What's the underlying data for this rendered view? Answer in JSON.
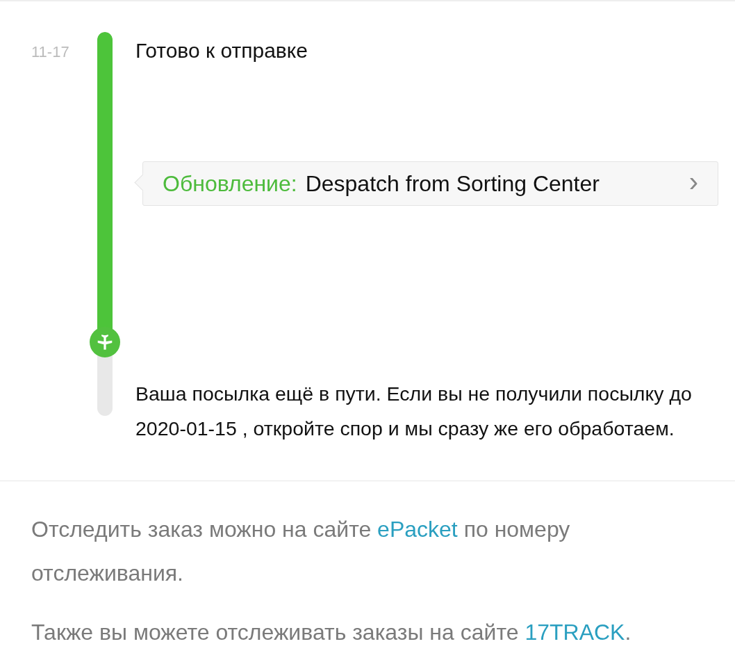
{
  "event": {
    "date": "11-17",
    "title": "Готово к отправке",
    "update": {
      "label": "Обновление:",
      "text": "Despatch from Sorting Center",
      "chevron": "›"
    },
    "notice": "Ваша посылка ещё в пути. Если вы не получили посылку до 2020-01-15 , откройте спор и мы сразу же его обработаем."
  },
  "footer": [
    {
      "before": "Отследить заказ можно на сайте ",
      "link": "ePacket",
      "after": " по номеру отслеживания."
    },
    {
      "before": "Также вы можете отслеживать заказы на сайте ",
      "link": "17TRACK",
      "after": "."
    }
  ]
}
